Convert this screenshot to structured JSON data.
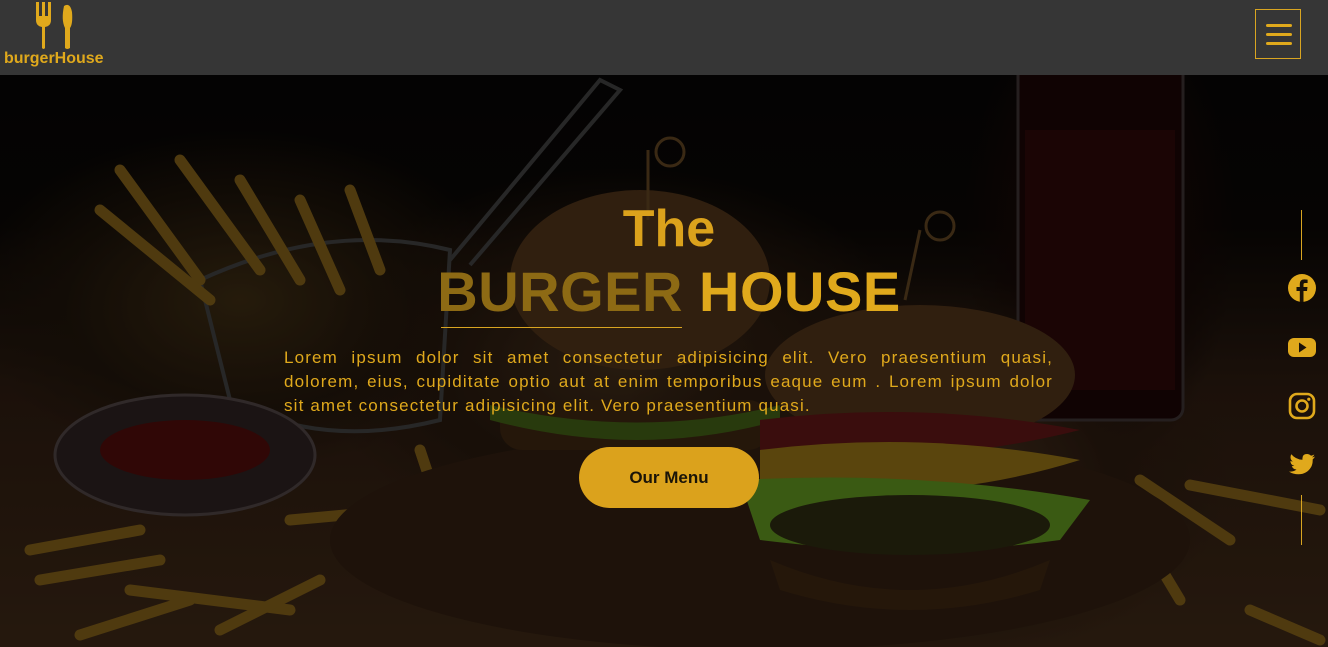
{
  "brand": {
    "name": "burgerHouse",
    "icon": "fork-knife-icon",
    "accent_color": "#e0a91c",
    "header_bg": "#363636"
  },
  "header": {
    "menu_icon": "hamburger-menu-icon"
  },
  "hero": {
    "title_top": "The",
    "title_word_1": "BURGER",
    "title_word_2": "HOUSE",
    "description": "Lorem ipsum dolor sit amet consectetur adipisicing elit. Vero praesentium quasi, dolorem, eius, cupiditate optio aut at enim temporibus eaque eum . Lorem ipsum dolor sit amet consectetur adipisicing elit. Vero praesentium quasi.",
    "cta_label": "Our Menu",
    "background": "burger and fries photo"
  },
  "social": {
    "items": [
      {
        "icon": "facebook-icon"
      },
      {
        "icon": "youtube-icon"
      },
      {
        "icon": "instagram-icon"
      },
      {
        "icon": "twitter-icon"
      }
    ]
  }
}
